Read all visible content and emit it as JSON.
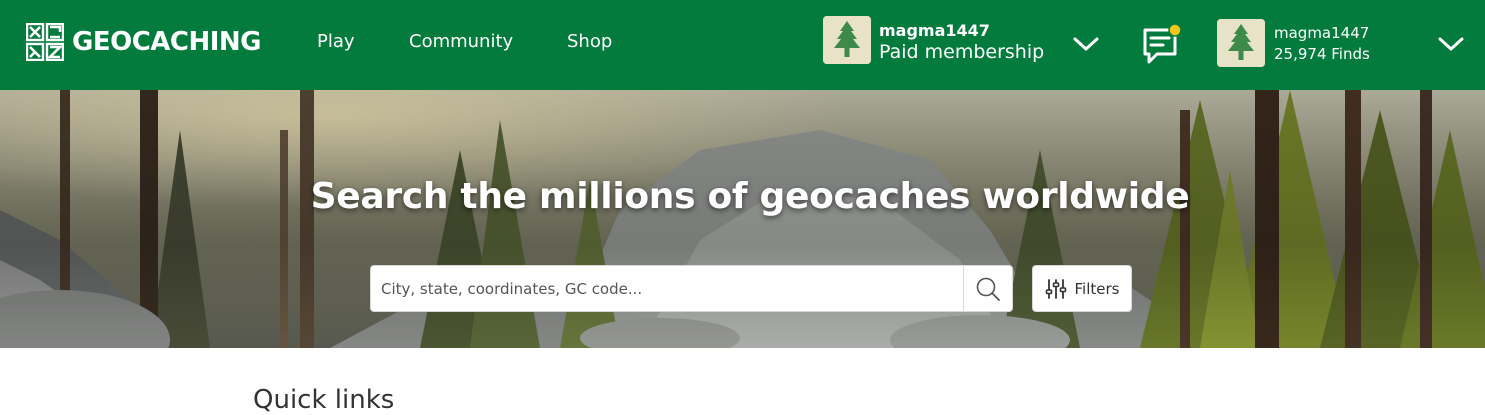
{
  "brand": {
    "name": "GEOCACHING"
  },
  "nav": {
    "items": [
      {
        "label": "Play"
      },
      {
        "label": "Community"
      },
      {
        "label": "Shop"
      }
    ]
  },
  "account": {
    "username": "magma1447",
    "membership": "Paid membership"
  },
  "profile": {
    "username": "magma1447",
    "finds": "25,974 Finds"
  },
  "notifications": {
    "has_unread": true,
    "dot_color": "#f5c518"
  },
  "hero": {
    "title": "Search the millions of geocaches worldwide"
  },
  "search": {
    "placeholder": "City, state, coordinates, GC code...",
    "value": ""
  },
  "filters": {
    "label": "Filters"
  },
  "sections": {
    "quick_links_title": "Quick links"
  },
  "colors": {
    "brand_green": "#037b3c",
    "avatar_bg": "#e7e2c8",
    "tree_green": "#3d8a4a"
  },
  "icons": {
    "logo": "geocaching-logo-icon",
    "search": "search-icon",
    "filters": "sliders-icon",
    "messages": "chat-icon",
    "dropdown": "chevron-down-icon",
    "avatar": "tree-avatar-icon"
  }
}
